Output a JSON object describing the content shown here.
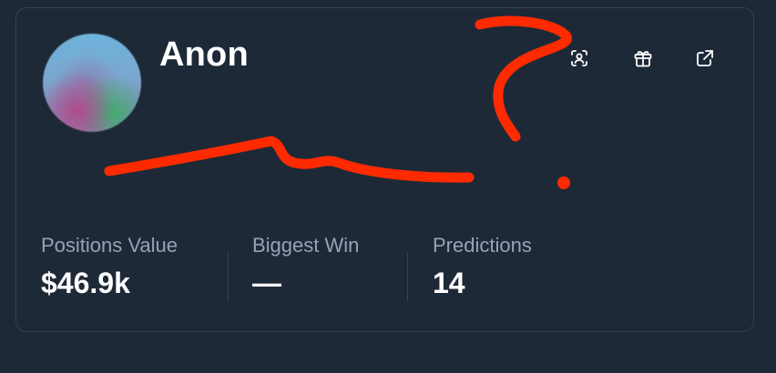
{
  "profile": {
    "username": "Anon"
  },
  "header_icons": [
    {
      "name": "face-scan-icon"
    },
    {
      "name": "gift-icon"
    },
    {
      "name": "external-link-icon"
    }
  ],
  "stats": [
    {
      "label": "Positions Value",
      "value": "$46.9k"
    },
    {
      "label": "Biggest Win",
      "value": "—"
    },
    {
      "label": "Predictions",
      "value": "14"
    }
  ],
  "colors": {
    "background": "#1e2937",
    "card_border": "#334155",
    "label": "#94a3b8",
    "value": "#ffffff",
    "annotation": "#ff2a00"
  }
}
